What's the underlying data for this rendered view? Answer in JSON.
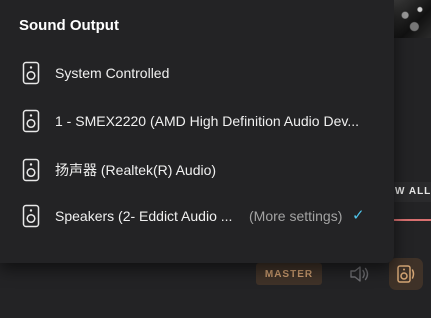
{
  "popup": {
    "title": "Sound Output",
    "devices": [
      {
        "label": "System Controlled",
        "icon": "speaker-icon",
        "selected": false
      },
      {
        "label": "1 - SMEX2220 (AMD High Definition Audio Dev...",
        "icon": "speaker-icon",
        "selected": false
      },
      {
        "label": "扬声器 (Realtek(R) Audio)",
        "icon": "speaker-icon",
        "selected": false
      },
      {
        "label": "Speakers (2- Eddict Audio ...",
        "icon": "speaker-icon",
        "selected": true,
        "more_settings": "(More settings)",
        "check": "✓"
      }
    ]
  },
  "player": {
    "view_all_label": "W ALL",
    "quality_badge": "MASTER",
    "volume_icon": "volume-icon",
    "output_icon": "speaker-output-icon"
  },
  "colors": {
    "background": "#232325",
    "text": "#f0f0f0",
    "muted_text": "#a3a3a3",
    "check": "#4fc3e8",
    "badge_bg": "#3f3228",
    "badge_text": "#c99a6e",
    "progress": "#d97070"
  }
}
